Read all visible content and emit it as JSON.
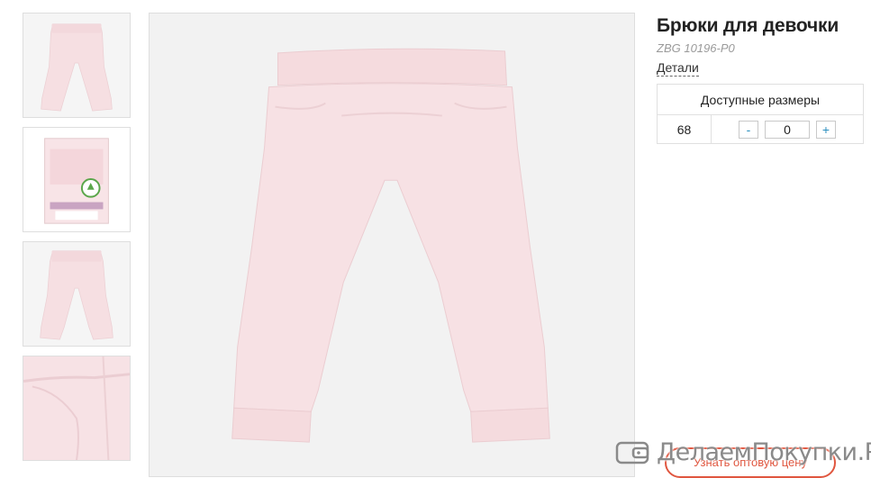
{
  "product": {
    "title": "Брюки для девочки",
    "sku": "ZBG 10196-P0",
    "details_label": "Детали"
  },
  "sizes_table": {
    "header": "Доступные размеры",
    "rows": [
      {
        "size": "68",
        "minus": "-",
        "quantity": "0",
        "plus": "+"
      }
    ]
  },
  "thumbnails": [
    {
      "name": "front-view",
      "icon": "pants-front-thumbnail"
    },
    {
      "name": "package-view",
      "icon": "package-thumbnail"
    },
    {
      "name": "back-view",
      "icon": "pants-back-thumbnail"
    },
    {
      "name": "pocket-closeup",
      "icon": "pocket-closeup-thumbnail"
    }
  ],
  "main_image": {
    "icon": "pink-pants-image"
  },
  "wholesale_button": {
    "label": "Узнать оптовую цену"
  },
  "watermark": {
    "text": "ДелаемПокупки.Ру",
    "icon": "wallet-icon"
  },
  "colors": {
    "pants": "#f6dfe2",
    "accent": "#2a8fbf",
    "button": "#e0563f",
    "border": "#dedede"
  }
}
